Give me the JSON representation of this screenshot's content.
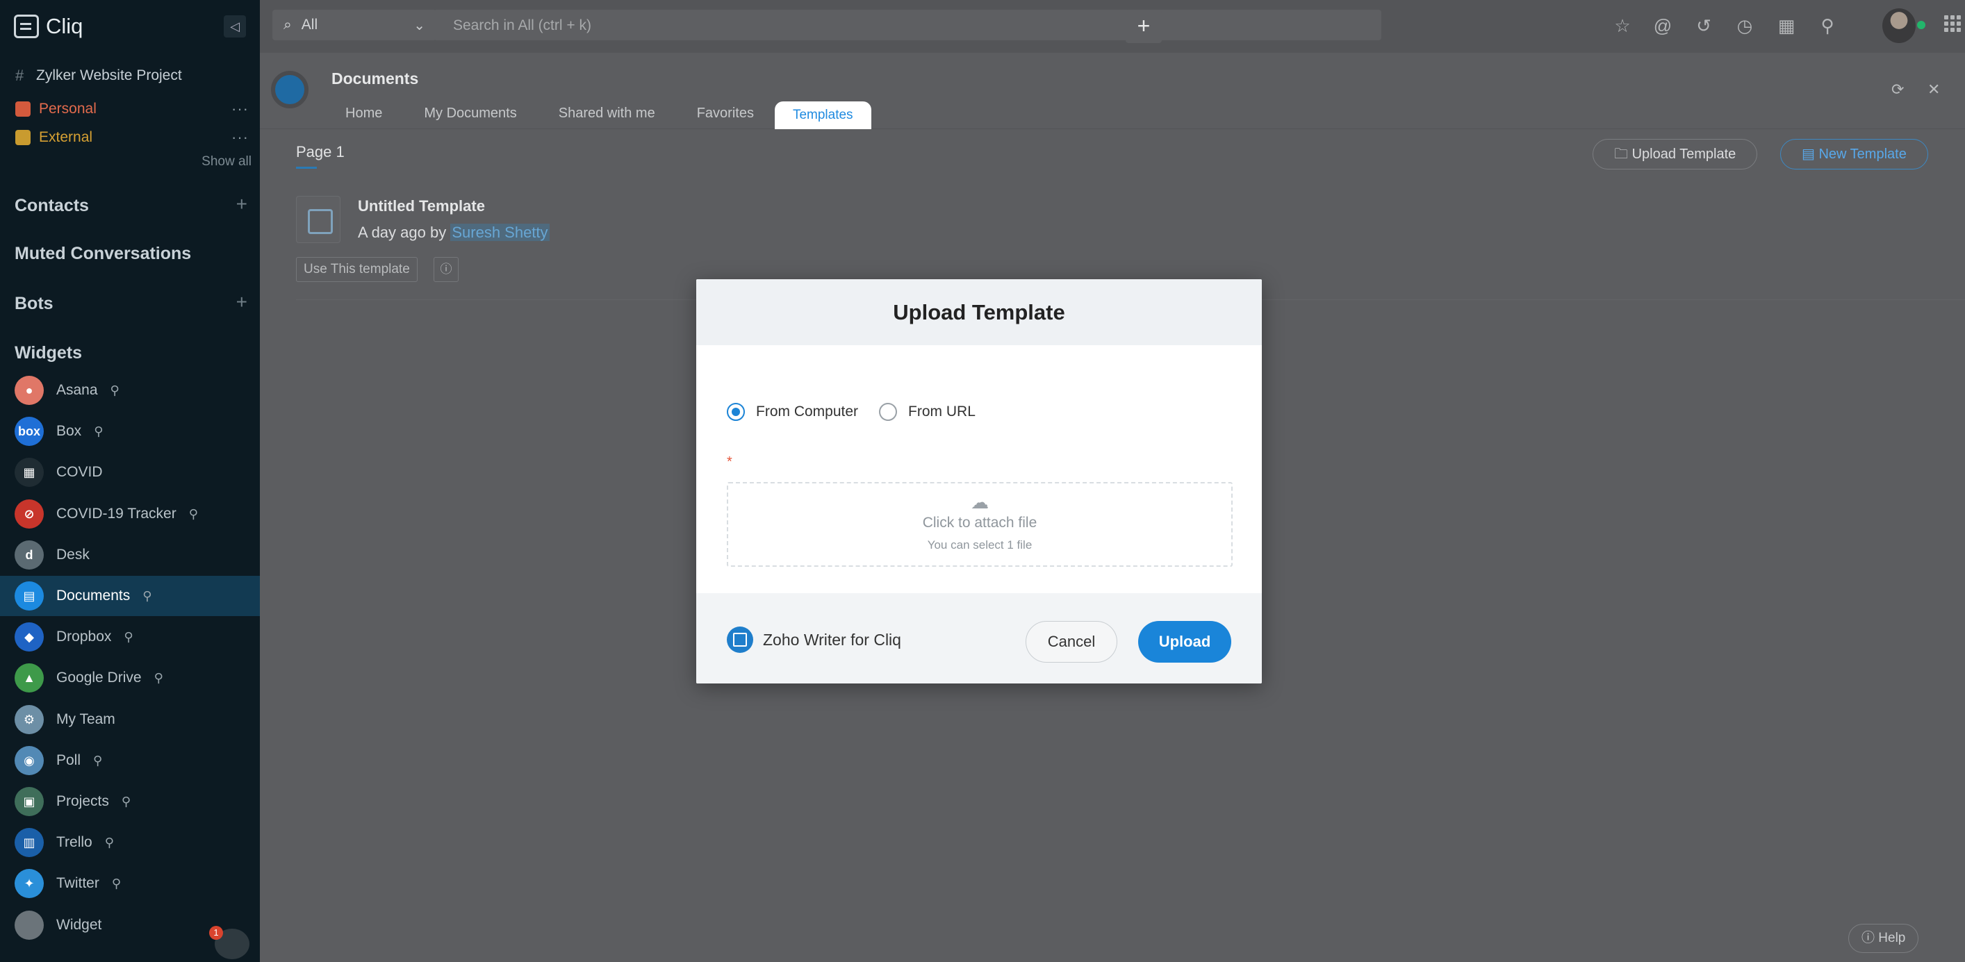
{
  "app": {
    "name": "Cliq"
  },
  "sidebar": {
    "channels": [
      {
        "prefix": "#",
        "label": "Zylker Website Project"
      },
      {
        "label": "Personal",
        "more": "···"
      },
      {
        "label": "External",
        "more": "···"
      }
    ],
    "show_all": "Show all",
    "sections": {
      "contacts": "Contacts",
      "muted": "Muted Conversations",
      "bots": "Bots",
      "widgets": "Widgets"
    },
    "add_symbol": "+",
    "widgets": [
      {
        "label": "Asana",
        "pinned": true,
        "color": "#e07767",
        "glyph": "●"
      },
      {
        "label": "Box",
        "pinned": true,
        "color": "#1f6fd6",
        "glyph": "box"
      },
      {
        "label": "COVID",
        "pinned": false,
        "color": "#1f2c33",
        "glyph": "▦"
      },
      {
        "label": "COVID-19 Tracker",
        "pinned": true,
        "color": "#c8352b",
        "glyph": "⊘"
      },
      {
        "label": "Desk",
        "pinned": false,
        "color": "#5b6a72",
        "glyph": "d"
      },
      {
        "label": "Documents",
        "pinned": true,
        "color": "#1c8ae0",
        "glyph": "▤"
      },
      {
        "label": "Dropbox",
        "pinned": true,
        "color": "#1f63c4",
        "glyph": "◆"
      },
      {
        "label": "Google Drive",
        "pinned": true,
        "color": "#3e9a4a",
        "glyph": "▲"
      },
      {
        "label": "My Team",
        "pinned": false,
        "color": "#6d8fa6",
        "glyph": "⚙"
      },
      {
        "label": "Poll",
        "pinned": true,
        "color": "#5289b5",
        "glyph": "◉"
      },
      {
        "label": "Projects",
        "pinned": true,
        "color": "#3f6e5a",
        "glyph": "▣"
      },
      {
        "label": "Trello",
        "pinned": true,
        "color": "#1a5fa8",
        "glyph": "▥"
      },
      {
        "label": "Twitter",
        "pinned": true,
        "color": "#2a8fd9",
        "glyph": "✦"
      },
      {
        "label": "Widget",
        "pinned": false,
        "color": "#6b747a",
        "glyph": ""
      }
    ],
    "active_widget": "Documents",
    "pin_symbol": "⚲",
    "notification_count": "1"
  },
  "topbar": {
    "search_scope": "All",
    "search_placeholder": "Search in All (ctrl + k)",
    "add_symbol": "+"
  },
  "documents": {
    "title": "Documents",
    "tabs": [
      "Home",
      "My Documents",
      "Shared with me",
      "Favorites",
      "Templates"
    ],
    "active_tab": "Templates",
    "page_label": "Page 1",
    "upload_template_label": "Upload Template",
    "new_template_label": "New Template",
    "template": {
      "name": "Untitled Template",
      "meta_prefix": "A day ago by",
      "author": "Suresh Shetty",
      "use_label": "Use This template"
    },
    "help_label": "ⓘ Help"
  },
  "modal": {
    "title": "Upload Template",
    "options": [
      "From Computer",
      "From URL"
    ],
    "selected_option": "From Computer",
    "required_mark": "*",
    "dropzone_title": "Click to attach file",
    "dropzone_subtitle": "You can select 1 file",
    "app_name": "Zoho Writer for Cliq",
    "cancel_label": "Cancel",
    "upload_label": "Upload",
    "accent": "#1a85d9"
  }
}
